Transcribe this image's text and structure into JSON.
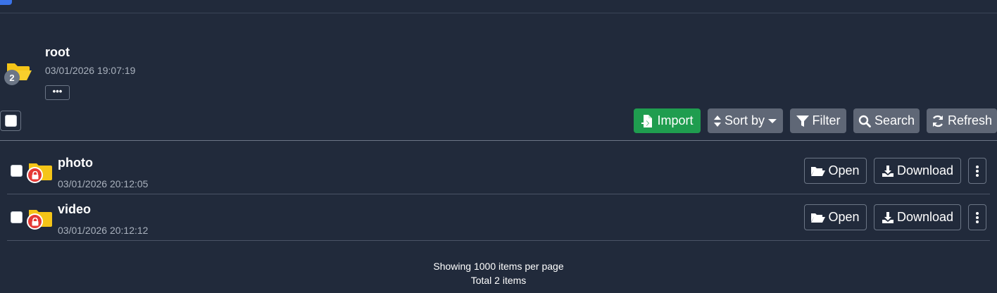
{
  "folder": {
    "title": "root",
    "date": "03/01/2026 19:07:19",
    "item_count_badge": "2",
    "more_label": "•••"
  },
  "toolbar": {
    "import_label": "Import",
    "sort_label": "Sort by",
    "filter_label": "Filter",
    "search_label": "Search",
    "refresh_label": "Refresh"
  },
  "items": [
    {
      "name": "photo",
      "date": "03/01/2026 20:12:05",
      "open_label": "Open",
      "download_label": "Download",
      "locked": true
    },
    {
      "name": "video",
      "date": "03/01/2026 20:12:12",
      "open_label": "Open",
      "download_label": "Download",
      "locked": true
    }
  ],
  "footer": {
    "per_page_text": "Showing 1000 items per page",
    "total_text": "Total 2 items"
  },
  "colors": {
    "background": "#212a3b",
    "import_button": "#1f9d4f",
    "secondary_button": "#5f6776",
    "folder_icon": "#f5c518",
    "lock_badge": "#e53935",
    "accent": "#3b73e8"
  }
}
